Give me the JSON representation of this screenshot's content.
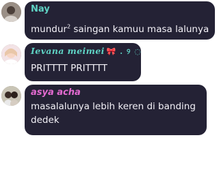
{
  "messages": [
    {
      "author": "Nay",
      "text_main": "mundur",
      "text_sup": "2",
      "text_rest": " saingan kamuu masa lalunya"
    },
    {
      "author": "Ievana meimei",
      "name_decoration": "🎀 . ୨ ◌",
      "text": "PRITTTT PRITTTT"
    },
    {
      "author": "asya acha",
      "text_line1": "masalalunya lebih keren di banding",
      "text_line2": "dedek"
    }
  ]
}
